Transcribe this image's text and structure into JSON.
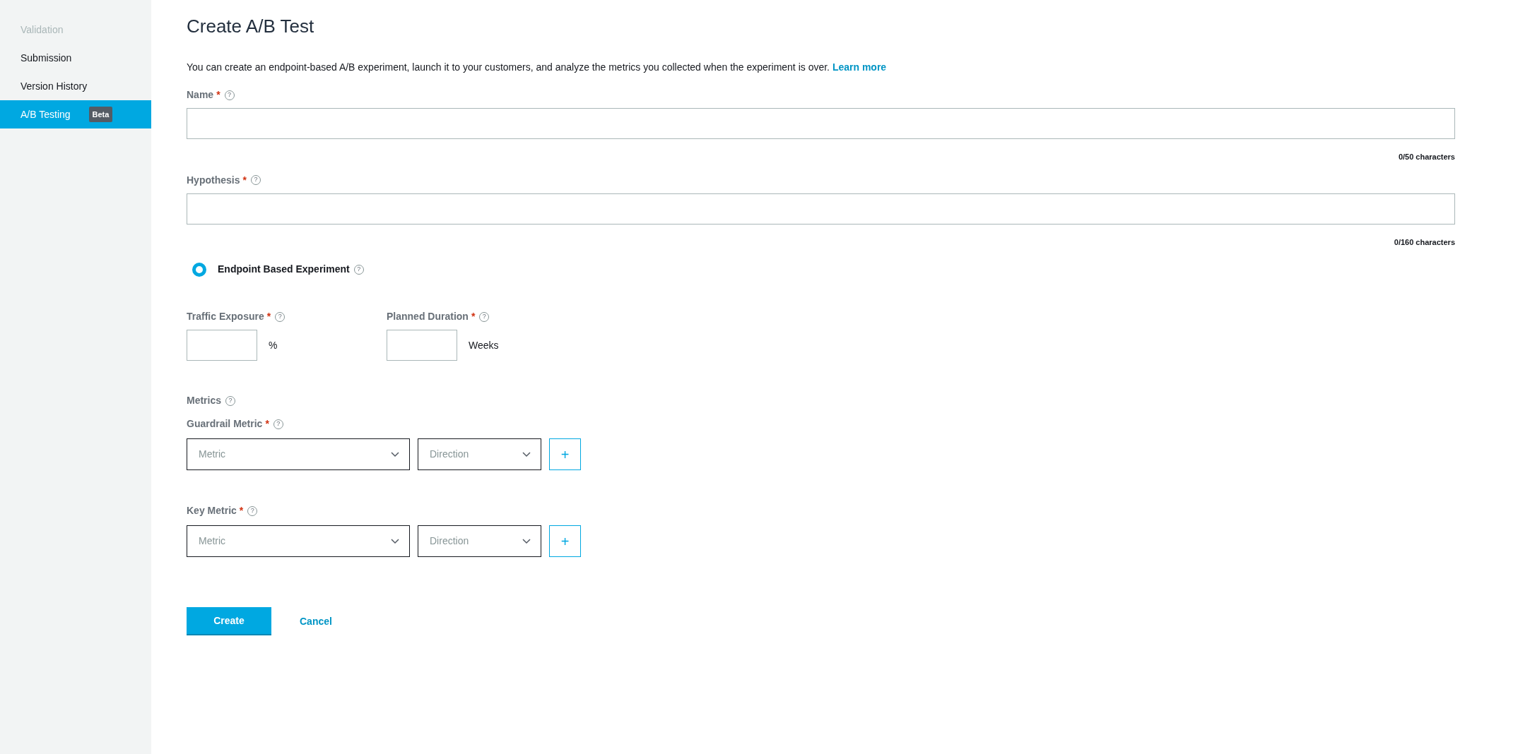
{
  "sidebar": {
    "items": [
      {
        "label": "Validation",
        "disabled": true,
        "selected": false
      },
      {
        "label": "Submission",
        "disabled": false,
        "selected": false
      },
      {
        "label": "Version History",
        "disabled": false,
        "selected": false
      },
      {
        "label": "A/B Testing",
        "disabled": false,
        "selected": true,
        "badge": "Beta"
      }
    ]
  },
  "title": "Create A/B Test",
  "description": {
    "text": "You can create an endpoint-based A/B experiment, launch it to your customers, and analyze the metrics you collected when the experiment is over.",
    "link": "Learn more"
  },
  "text_fields": [
    {
      "label": "Name",
      "required_mark": "*",
      "help": "?",
      "counter": "0/50 characters"
    },
    {
      "label": "Hypothesis",
      "required_mark": "*",
      "help": "?",
      "counter": "0/160 characters"
    }
  ],
  "experiment_type": {
    "label": "Endpoint Based Experiment",
    "help": "?",
    "selected": true
  },
  "number_fields": [
    {
      "label": "Traffic Exposure",
      "required_mark": "*",
      "help": "?",
      "unit": "%"
    },
    {
      "label": "Planned Duration",
      "required_mark": "*",
      "help": "?",
      "unit": "Weeks"
    }
  ],
  "metrics": {
    "label": "Metrics",
    "help": "?",
    "groups": [
      {
        "label": "Guardrail Metric",
        "required_mark": "*",
        "help": "?",
        "metric_placeholder": "Metric",
        "direction_placeholder": "Direction",
        "add_button": "+"
      },
      {
        "label": "Key Metric",
        "required_mark": "*",
        "help": "?",
        "metric_placeholder": "Metric",
        "direction_placeholder": "Direction",
        "add_button": "+"
      }
    ]
  },
  "buttons": {
    "create": "Create",
    "cancel": "Cancel"
  }
}
